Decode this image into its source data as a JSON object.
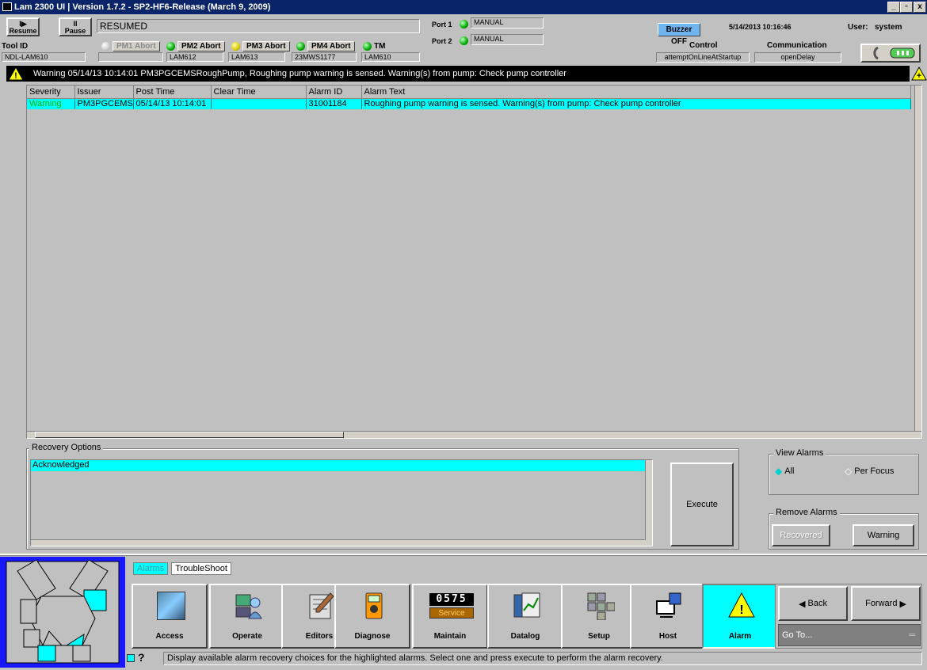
{
  "window": {
    "title": "Lam 2300 UI  |  Version 1.7.2 - SP2-HF6-Release (March 9, 2009)",
    "min": "_",
    "max": "▫",
    "close": "x"
  },
  "toolbar": {
    "resume": "Resume",
    "pause": "Pause",
    "state": "RESUMED"
  },
  "ports": [
    {
      "label": "Port 1",
      "mode": "MANUAL"
    },
    {
      "label": "Port 2",
      "mode": "MANUAL"
    }
  ],
  "buzzer": "Buzzer OFF",
  "datetime": "5/14/2013 10:16:46",
  "user_label": "User:",
  "user": "system",
  "control": {
    "label": "Control",
    "value": "attemptOnLineAtStartup"
  },
  "communication": {
    "label": "Communication",
    "value": "openDelay"
  },
  "tool": {
    "label": "Tool ID",
    "value": "NDL-LAM610"
  },
  "pms": [
    {
      "btn": "PM1 Abort",
      "value": ""
    },
    {
      "btn": "PM2 Abort",
      "value": "LAM612"
    },
    {
      "btn": "PM3 Abort",
      "value": "LAM613"
    },
    {
      "btn": "PM4 Abort",
      "value": "23MWS1177"
    },
    {
      "btn": "TM",
      "value": "LAM610"
    }
  ],
  "banner": "Warning 05/14/13 10:14:01 PM3PGCEMSRoughPump, Roughing pump warning is sensed. Warning(s) from pump: Check pump controller",
  "table": {
    "headers": [
      "Severity",
      "Issuer",
      "Post Time",
      "Clear Time",
      "Alarm ID",
      "Alarm Text"
    ],
    "rows": [
      [
        "Warning",
        "PM3PGCEMS",
        "05/14/13 10:14:01",
        "",
        "31001184",
        "Roughing pump warning is sensed. Warning(s) from pump: Check pump controller"
      ]
    ]
  },
  "recovery": {
    "title": "Recovery Options",
    "options": [
      "Acknowledged"
    ],
    "execute": "Execute"
  },
  "view_alarms": {
    "title": "View Alarms",
    "all": "All",
    "per_focus": "Per Focus"
  },
  "remove_alarms": {
    "title": "Remove Alarms",
    "recovered": "Recovered",
    "warning": "Warning"
  },
  "tabs": [
    "Alarms",
    "TroubleShoot"
  ],
  "nav": [
    "Access",
    "Operate",
    "Editors",
    "Diagnose",
    "Maintain",
    "Datalog",
    "Setup",
    "Host",
    "Alarm"
  ],
  "maintain_counter": "0575",
  "maintain_service": "Service",
  "back": "Back",
  "forward": "Forward",
  "goto": "Go To...",
  "status": "Display available alarm recovery choices for the highlighted alarms. Select one and press execute to perform the alarm recovery.",
  "colors": {
    "highlight": "#00ffff",
    "titlebar": "#0a246a",
    "warning": "#00c000",
    "panel": "#c0c0c0"
  }
}
